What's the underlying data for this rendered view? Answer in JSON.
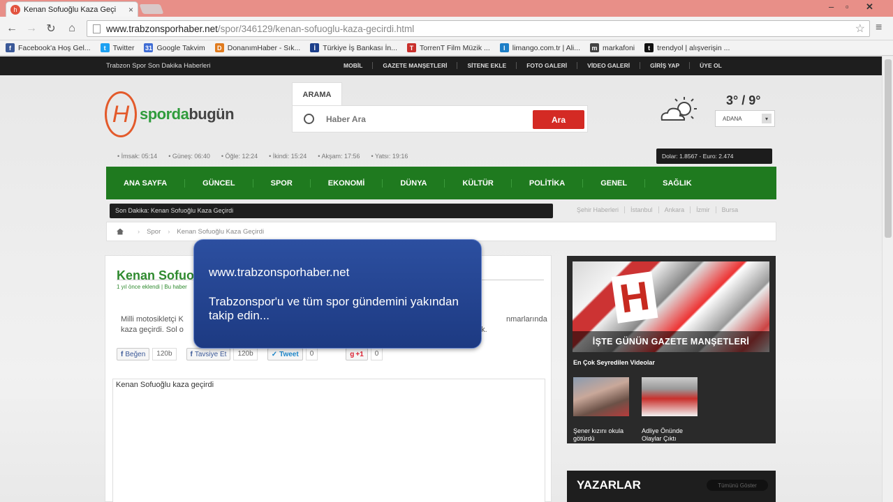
{
  "browser": {
    "tab_title": "Kenan Sofuoğlu Kaza Geçi",
    "url_host": "www.trabzonsporhaber.net",
    "url_path": "/spor/346129/kenan-sofuoglu-kaza-gecirdi.html",
    "bookmarks": [
      {
        "label": "Facebook'a Hoş Gel...",
        "color": "#3b5998",
        "glyph": "f"
      },
      {
        "label": "Twitter",
        "color": "#1da1f2",
        "glyph": "t"
      },
      {
        "label": "Google Takvim",
        "color": "#3f6cd4",
        "glyph": "31"
      },
      {
        "label": "DonanımHaber - Sık...",
        "color": "#e07b1e",
        "glyph": "D"
      },
      {
        "label": "Türkiye İş Bankası İn...",
        "color": "#1c3f8b",
        "glyph": "İ"
      },
      {
        "label": "TorrenT Film Müzik ...",
        "color": "#c9302c",
        "glyph": "T"
      },
      {
        "label": "limango.com.tr | Ali...",
        "color": "#1e7fc7",
        "glyph": "l"
      },
      {
        "label": "markafoni",
        "color": "#444444",
        "glyph": "m"
      },
      {
        "label": "trendyol | alışverişin ...",
        "color": "#111111",
        "glyph": "t"
      }
    ]
  },
  "site": {
    "topbar_title": "Trabzon Spor Son Dakika Haberleri",
    "topbar_nav": [
      "MOBİL",
      "GAZETE MANŞETLERİ",
      "SİTENE EKLE",
      "FOTO GALERİ",
      "VİDEO GALERİ",
      "GİRİŞ YAP",
      "ÜYE OL"
    ],
    "logo_a": "sporda",
    "logo_b": "bugün",
    "search": {
      "tab": "ARAMA",
      "placeholder": "Haber Ara",
      "button": "Ara"
    },
    "weather": {
      "temp": "3° / 9°",
      "city": "ADANA"
    },
    "prayer_times": [
      "İmsak: 05:14",
      "Güneş: 06:40",
      "Öğle: 12:24",
      "İkindi: 15:24",
      "Akşam: 17:56",
      "Yatsı: 19:16"
    ],
    "currency": "Dolar: 1.8567 - Euro: 2.474",
    "main_nav": [
      "ANA SAYFA",
      "GÜNCEL",
      "SPOR",
      "EKONOMİ",
      "DÜNYA",
      "KÜLTÜR",
      "POLİTİKA",
      "GENEL",
      "SAĞLIK"
    ],
    "breaking": "Son Dakika:  Kenan Sofuoğlu Kaza Geçirdi",
    "cities": [
      "Şehir Haberleri",
      "İstanbul",
      "Ankara",
      "İzmir",
      "Bursa"
    ],
    "breadcrumb": [
      "Spor",
      "Kenan Sofuoğlu Kaza Geçirdi"
    ],
    "article": {
      "title": "Kenan Sofuoğlu Kaza Geçirdi",
      "meta": "1 yıl önce eklendi | Bu haber",
      "lead_start": "Milli motosikletçi K",
      "lead_end": "nmarlarında",
      "lead_line2": "kaza geçirdi. Sol o",
      "lead_tail2": "ak.",
      "like": "Beğen",
      "like_count": "120b",
      "recommend": "Tavsiye Et",
      "recommend_count": "120b",
      "tweet": "Tweet",
      "tweet_count": "0",
      "gplus": "+1",
      "gplus_count": "0",
      "body": "Kenan Sofuoğlu kaza geçirdi"
    },
    "sidebar": {
      "gazette_caption": "İŞTE GÜNÜN GAZETE MANŞETLERİ",
      "video_head": "En Çok Seyredilen Videolar",
      "video1": "Şener kızını okula götürdü",
      "video2": "Adliye Önünde Olaylar Çıktı"
    },
    "yazarlar": {
      "title": "YAZARLAR",
      "all": "Tümünü Göster"
    }
  },
  "overlay": {
    "url": "www.trabzonsporhaber.net",
    "message": "Trabzonspor'u ve tüm spor gündemini yakından takip edin..."
  },
  "colors": {
    "accent_green": "#1f7a1f",
    "search_red": "#d42a24",
    "overlay_blue": "#2c4fa0"
  }
}
